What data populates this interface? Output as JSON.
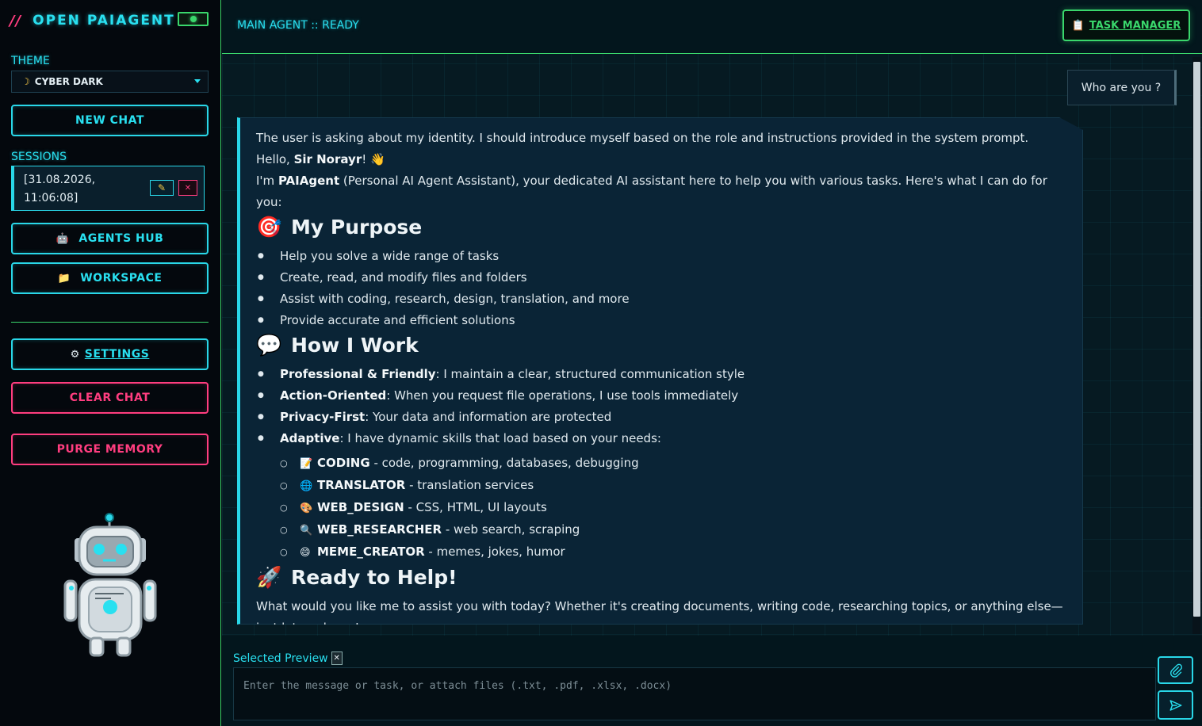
{
  "sidebar": {
    "brand_slashes": "//",
    "brand_title": "OPEN PAIAGENT",
    "theme_label": "THEME",
    "theme_value": "CYBER DARK",
    "new_chat": "NEW CHAT",
    "sessions_label": "SESSIONS",
    "session_item": {
      "date": "[31.08.2026,",
      "time": "11:06:08]"
    },
    "agents_hub": "AGENTS HUB",
    "workspace": "WORKSPACE",
    "settings": "SETTINGS",
    "clear_chat": "CLEAR CHAT",
    "purge_memory": "PURGE MEMORY"
  },
  "header": {
    "agent_status": "MAIN AGENT :: READY",
    "task_manager": "TASK MANAGER"
  },
  "chat": {
    "user_message": "Who are you ?",
    "agent": {
      "thinking": "The user is asking about my identity. I should introduce myself based on the role and instructions provided in the system prompt.",
      "greeting_prefix": "Hello, ",
      "greeting_name": "Sir Norayr",
      "greeting_suffix": "! 👋",
      "intro_prefix": "I'm ",
      "intro_name": "PAIAgent",
      "intro_suffix": " (Personal AI Agent Assistant), your dedicated AI assistant here to help you with various tasks. Here's what I can do for you:",
      "purpose_emoji": "🎯",
      "purpose_title": "My Purpose",
      "purpose_items": [
        "Help you solve a wide range of tasks",
        "Create, read, and modify files and folders",
        "Assist with coding, research, design, translation, and more",
        "Provide accurate and efficient solutions"
      ],
      "work_emoji": "💬",
      "work_title": "How I Work",
      "work_items": [
        {
          "bold": "Professional & Friendly",
          "text": ": I maintain a clear, structured communication style"
        },
        {
          "bold": "Action-Oriented",
          "text": ": When you request file operations, I use tools immediately"
        },
        {
          "bold": "Privacy-First",
          "text": ": Your data and information are protected"
        },
        {
          "bold": "Adaptive",
          "text": ": I have dynamic skills that load based on your needs:"
        }
      ],
      "skills": [
        {
          "icon": "📝",
          "name": "CODING",
          "desc": " - code, programming, databases, debugging"
        },
        {
          "icon": "🌐",
          "name": "TRANSLATOR",
          "desc": " - translation services"
        },
        {
          "icon": "🎨",
          "name": "WEB_DESIGN",
          "desc": " - CSS, HTML, UI layouts"
        },
        {
          "icon": "🔍",
          "name": "WEB_RESEARCHER",
          "desc": " - web search, scraping"
        },
        {
          "icon": "😄",
          "name": "MEME_CREATOR",
          "desc": " - memes, jokes, humor"
        }
      ],
      "ready_emoji": "🚀",
      "ready_title": "Ready to Help!",
      "closing": "What would you like me to assist you with today? Whether it's creating documents, writing code, researching topics, or anything else—just let me know!"
    }
  },
  "composer": {
    "preview_label": "Selected Preview",
    "placeholder": "Enter the message or task, or attach files (.txt, .pdf, .xlsx, .docx)"
  },
  "colors": {
    "accent_cyan": "#29e0f0",
    "accent_green": "#3ad76c",
    "accent_pink": "#ff3d7f",
    "background": "#060d14"
  }
}
